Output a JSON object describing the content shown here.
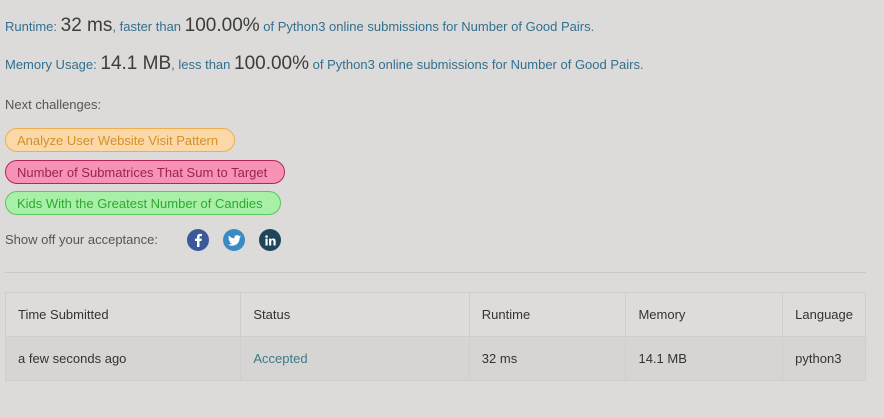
{
  "runtime_line": {
    "label": "Runtime: ",
    "value": "32 ms",
    "mid": ", faster than ",
    "percent": "100.00%",
    "tail": " of Python3 online submissions for Number of Good Pairs."
  },
  "memory_line": {
    "label": "Memory Usage: ",
    "value": "14.1 MB",
    "mid": ", less than ",
    "percent": "100.00%",
    "tail": " of Python3 online submissions for Number of Good Pairs."
  },
  "next_challenges": {
    "label": "Next challenges:",
    "items": [
      "Analyze User Website Visit Pattern",
      "Number of Submatrices That Sum to Target",
      "Kids With the Greatest Number of Candies"
    ]
  },
  "share": {
    "label": "Show off your acceptance:",
    "icons": [
      "facebook-icon",
      "twitter-icon",
      "linkedin-icon"
    ]
  },
  "table": {
    "headers": [
      "Time Submitted",
      "Status",
      "Runtime",
      "Memory",
      "Language"
    ],
    "rows": [
      [
        "a few seconds ago",
        "Accepted",
        "32 ms",
        "14.1 MB",
        "python3"
      ]
    ]
  },
  "colors": {
    "background": "#dcdbd9",
    "link": "#336f8f",
    "chip_easy_fill": "#fbd8a7",
    "chip_hard_fill": "#f592b5",
    "chip_medium_fill": "#a8f0a8"
  }
}
